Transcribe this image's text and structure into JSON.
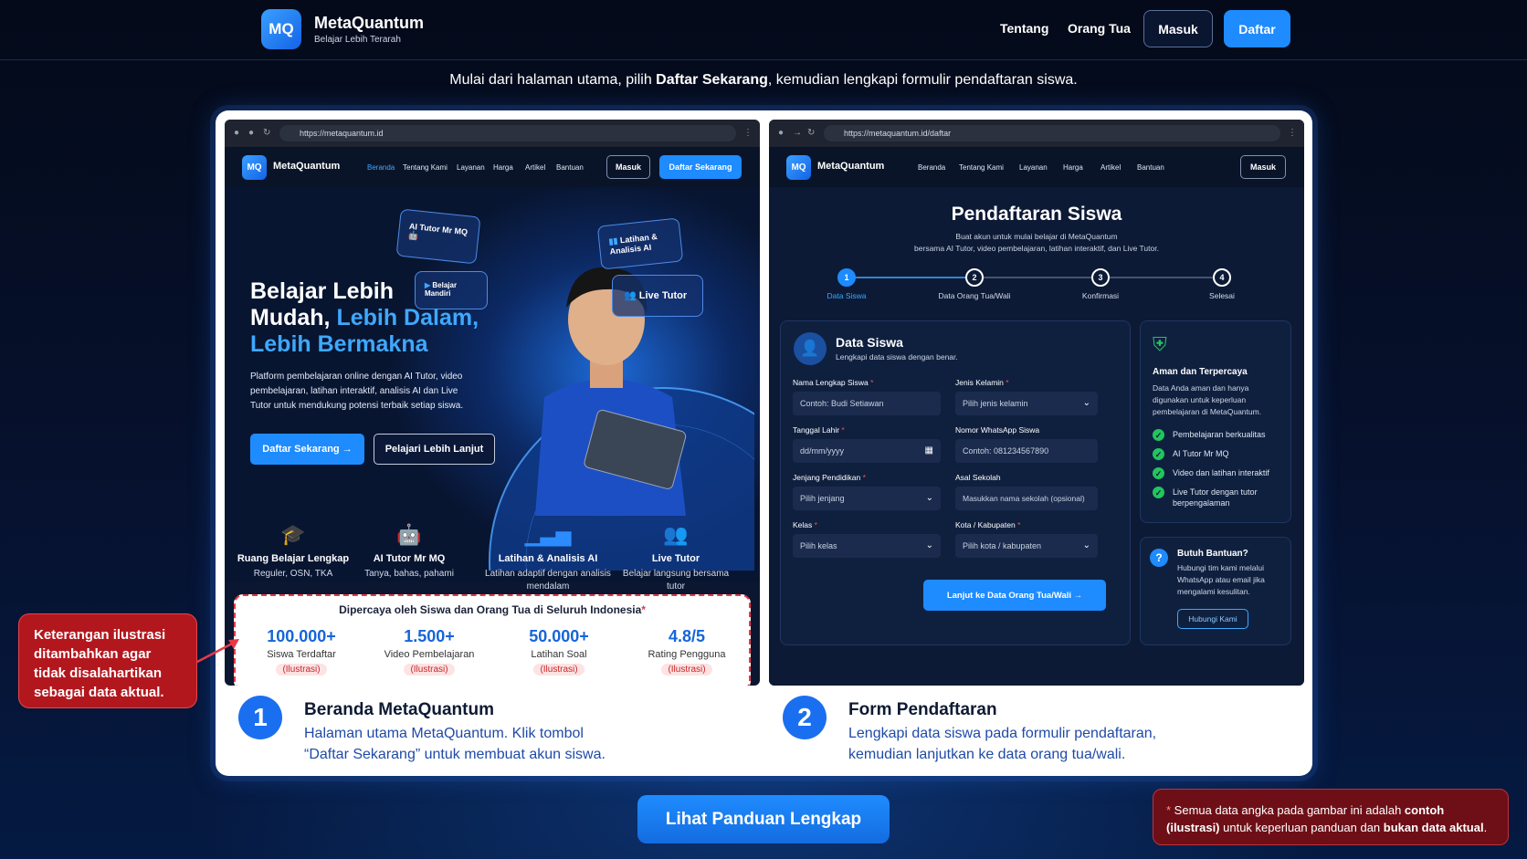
{
  "header": {
    "logo": "MQ",
    "brand": "MetaQuantum",
    "tagline": "Belajar Lebih Terarah",
    "nav": [
      "Tentang",
      "Orang Tua"
    ],
    "login": "Masuk",
    "register": "Daftar"
  },
  "instruction": {
    "pre": "Mulai dari halaman utama, pilih ",
    "bold": "Daftar Sekarang",
    "post": ", kemudian lengkapi formulir pendaftaran siswa."
  },
  "home": {
    "url": "https://metaquantum.id",
    "nav": [
      "Beranda",
      "Tentang Kami",
      "Layanan",
      "Harga",
      "Artikel",
      "Bantuan"
    ],
    "login": "Masuk",
    "cta_nav": "Daftar Sekarang",
    "headline_1": "Belajar Lebih",
    "headline_2a": "Mudah, ",
    "headline_2b": "Lebih Dalam,",
    "headline_3": "Lebih Bermakna",
    "desc": "Platform pembelajaran online dengan AI Tutor, video pembelajaran, latihan interaktif, analisis AI dan Live Tutor untuk mendukung potensi terbaik setiap siswa.",
    "cta_primary": "Daftar Sekarang →",
    "cta_secondary": "Pelajari Lebih Lanjut",
    "floats": {
      "ai": "AI Tutor Mr MQ",
      "analysis": "Latihan & Analisis AI",
      "self": "Belajar Mandiri",
      "live": "Live Tutor"
    },
    "features": [
      {
        "icon": "graduation-cap-icon",
        "title": "Ruang Belajar Lengkap",
        "sub": "Reguler, OSN, TKA"
      },
      {
        "icon": "robot-icon",
        "title": "AI Tutor Mr MQ",
        "sub": "Tanya, bahas, pahami"
      },
      {
        "icon": "bar-chart-icon",
        "title": "Latihan & Analisis AI",
        "sub": "Latihan adaptif dengan analisis mendalam"
      },
      {
        "icon": "users-icon",
        "title": "Live Tutor",
        "sub": "Belajar langsung bersama tutor"
      }
    ],
    "stats_title": "Dipercaya oleh Siswa dan Orang Tua di Seluruh Indonesia",
    "stats_star": "*",
    "stats": [
      {
        "value": "100.000+",
        "label": "Siswa Terdaftar",
        "badge": "(Ilustrasi)"
      },
      {
        "value": "1.500+",
        "label": "Video Pembelajaran",
        "badge": "(Ilustrasi)"
      },
      {
        "value": "50.000+",
        "label": "Latihan Soal",
        "badge": "(Ilustrasi)"
      },
      {
        "value": "4.8/5",
        "label": "Rating Pengguna",
        "badge": "(Ilustrasi)"
      }
    ]
  },
  "form": {
    "url": "https://metaquantum.id/daftar",
    "nav": [
      "Beranda",
      "Tentang Kami",
      "Layanan",
      "Harga",
      "Artikel",
      "Bantuan"
    ],
    "login": "Masuk",
    "title": "Pendaftaran Siswa",
    "subtitle_1": "Buat akun untuk mulai belajar di MetaQuantum",
    "subtitle_2": "bersama AI Tutor, video pembelajaran, latihan interaktif, dan Live Tutor.",
    "steps": [
      {
        "n": "1",
        "label": "Data Siswa"
      },
      {
        "n": "2",
        "label": "Data Orang Tua/Wali"
      },
      {
        "n": "3",
        "label": "Konfirmasi"
      },
      {
        "n": "4",
        "label": "Selesai"
      }
    ],
    "section_title": "Data Siswa",
    "section_sub": "Lengkapi data siswa dengan benar.",
    "fields": {
      "name": {
        "label": "Nama Lengkap Siswa",
        "value": "Contoh: Budi Setiawan"
      },
      "gender": {
        "label": "Jenis Kelamin",
        "value": "Pilih jenis kelamin"
      },
      "dob": {
        "label": "Tanggal Lahir",
        "value": "dd/mm/yyyy"
      },
      "phone": {
        "label": "Nomor WhatsApp Siswa",
        "value": "Contoh: 081234567890"
      },
      "level": {
        "label": "Jenjang Pendidikan",
        "value": "Pilih jenjang"
      },
      "school": {
        "label": "Asal Sekolah",
        "value": "Masukkan nama sekolah (opsional)"
      },
      "class": {
        "label": "Kelas",
        "value": "Pilih kelas"
      },
      "city": {
        "label": "Kota / Kabupaten",
        "value": "Pilih kota / kabupaten"
      }
    },
    "required": "*",
    "next": "Lanjut ke Data Orang Tua/Wali →",
    "trust_title": "Aman dan Terpercaya",
    "trust_desc": "Data Anda aman dan hanya digunakan untuk keperluan pembelajaran di MetaQuantum.",
    "checks": [
      "Pembelajaran berkualitas",
      "AI Tutor Mr MQ",
      "Video dan latihan interaktif",
      "Live Tutor dengan tutor berpengalaman"
    ],
    "help_title": "Butuh Bantuan?",
    "help_desc": "Hubungi tim kami melalui WhatsApp atau email jika mengalami kesulitan.",
    "help_button": "Hubungi Kami"
  },
  "captions": [
    {
      "n": "1",
      "title": "Beranda MetaQuantum",
      "desc_1": "Halaman utama MetaQuantum. Klik tombol",
      "desc_2": "“Daftar Sekarang” untuk membuat akun siswa."
    },
    {
      "n": "2",
      "title": "Form Pendaftaran",
      "desc_1": "Lengkapi data siswa pada formulir pendaftaran,",
      "desc_2": "kemudian lanjutkan ke data orang tua/wali."
    }
  ],
  "callout": "Keterangan ilustrasi ditambahkan agar tidak disalahartikan sebagai data aktual.",
  "guide_button": "Lihat Panduan Lengkap",
  "note": {
    "star": "* ",
    "p1": "Semua data angka pada gambar ini adalah ",
    "b1": "contoh (ilustrasi)",
    "p2": " untuk keperluan panduan dan ",
    "b2": "bukan data aktual",
    "p3": "."
  }
}
